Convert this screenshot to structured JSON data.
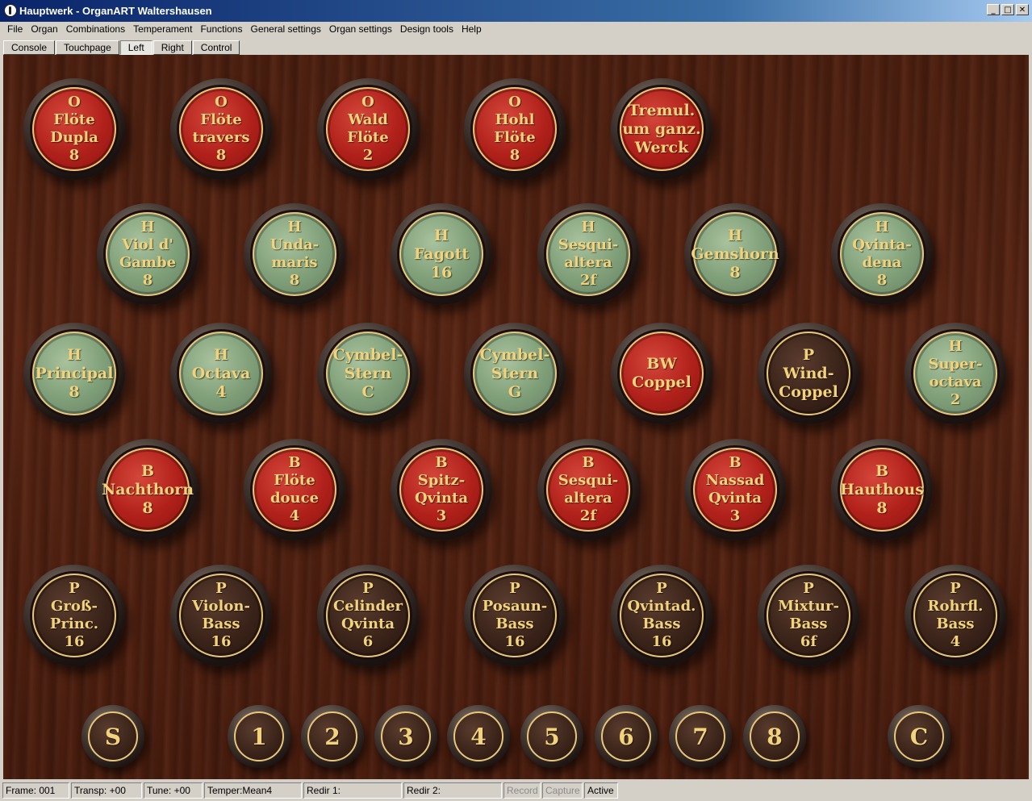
{
  "window": {
    "title": "Hauptwerk - OrganART Waltershausen"
  },
  "menu": [
    "File",
    "Organ",
    "Combinations",
    "Temperament",
    "Functions",
    "General settings",
    "Organ settings",
    "Design tools",
    "Help"
  ],
  "tabs": [
    {
      "label": "Console",
      "active": false
    },
    {
      "label": "Touchpage",
      "active": false
    },
    {
      "label": "Left",
      "active": true
    },
    {
      "label": "Right",
      "active": false
    },
    {
      "label": "Control",
      "active": false
    }
  ],
  "colors": {
    "red": "#b0201a",
    "green": "#7e9e78",
    "dark": "#3a2319",
    "gold": "#f2d27a"
  },
  "stops": [
    [
      {
        "label": "O\nFlöte\nDupla\n8",
        "color": "red"
      },
      {
        "label": "O\nFlöte\ntravers\n8",
        "color": "red"
      },
      {
        "label": "O\nWald\nFlöte\n2",
        "color": "red"
      },
      {
        "label": "O\nHohl\nFlöte\n8",
        "color": "red"
      },
      {
        "label": "Tremul.\num ganz.\nWerck",
        "color": "red"
      }
    ],
    [
      {
        "label": "H\nViol d'\nGambe\n8",
        "color": "green"
      },
      {
        "label": "H\nUnda-\nmaris\n8",
        "color": "green"
      },
      {
        "label": "H\nFagott\n16",
        "color": "green"
      },
      {
        "label": "H\nSesqui-\naltera\n2f",
        "color": "green"
      },
      {
        "label": "H\nGemshorn\n8",
        "color": "green"
      },
      {
        "label": "H\nQvinta-\ndena\n8",
        "color": "green"
      }
    ],
    [
      {
        "label": "H\nPrincipal\n8",
        "color": "green"
      },
      {
        "label": "H\nOctava\n4",
        "color": "green"
      },
      {
        "label": "Cymbel-\nStern\nC",
        "color": "green"
      },
      {
        "label": "Cymbel-\nStern\nG",
        "color": "green"
      },
      {
        "label": "BW\nCoppel",
        "color": "red"
      },
      {
        "label": "P\nWind-\nCoppel",
        "color": "dark"
      },
      {
        "label": "H\nSuper-\noctava\n2",
        "color": "green"
      }
    ],
    [
      {
        "label": "B\nNachthorn\n8",
        "color": "red"
      },
      {
        "label": "B\nFlöte\ndouce\n4",
        "color": "red"
      },
      {
        "label": "B\nSpitz-\nQvinta\n3",
        "color": "red"
      },
      {
        "label": "B\nSesqui-\naltera\n2f",
        "color": "red"
      },
      {
        "label": "B\nNassad\nQvinta\n3",
        "color": "red"
      },
      {
        "label": "B\nHauthous\n8",
        "color": "red"
      }
    ],
    [
      {
        "label": "P\nGroß-\nPrinc.\n16",
        "color": "dark"
      },
      {
        "label": "P\nViolon-\nBass\n16",
        "color": "dark"
      },
      {
        "label": "P\nCelinder\nQvinta\n6",
        "color": "dark"
      },
      {
        "label": "P\nPosaun-\nBass\n16",
        "color": "dark"
      },
      {
        "label": "P\nQvintad.\nBass\n16",
        "color": "dark"
      },
      {
        "label": "P\nMixtur-\nBass\n6f",
        "color": "dark"
      },
      {
        "label": "P\nRohrfl.\nBass\n4",
        "color": "dark"
      }
    ]
  ],
  "pistons": [
    "S",
    "1",
    "2",
    "3",
    "4",
    "5",
    "6",
    "7",
    "8",
    "C"
  ],
  "status": [
    {
      "text": "Frame: 001",
      "enabled": true
    },
    {
      "text": "Transp: +00",
      "enabled": true
    },
    {
      "text": "Tune: +00",
      "enabled": true
    },
    {
      "text": "Temper:Mean4",
      "enabled": true
    },
    {
      "text": "Redir 1:",
      "enabled": true
    },
    {
      "text": "Redir 2:",
      "enabled": true
    },
    {
      "text": "Record",
      "enabled": false
    },
    {
      "text": "Capture",
      "enabled": false
    },
    {
      "text": "Active",
      "enabled": true
    }
  ]
}
